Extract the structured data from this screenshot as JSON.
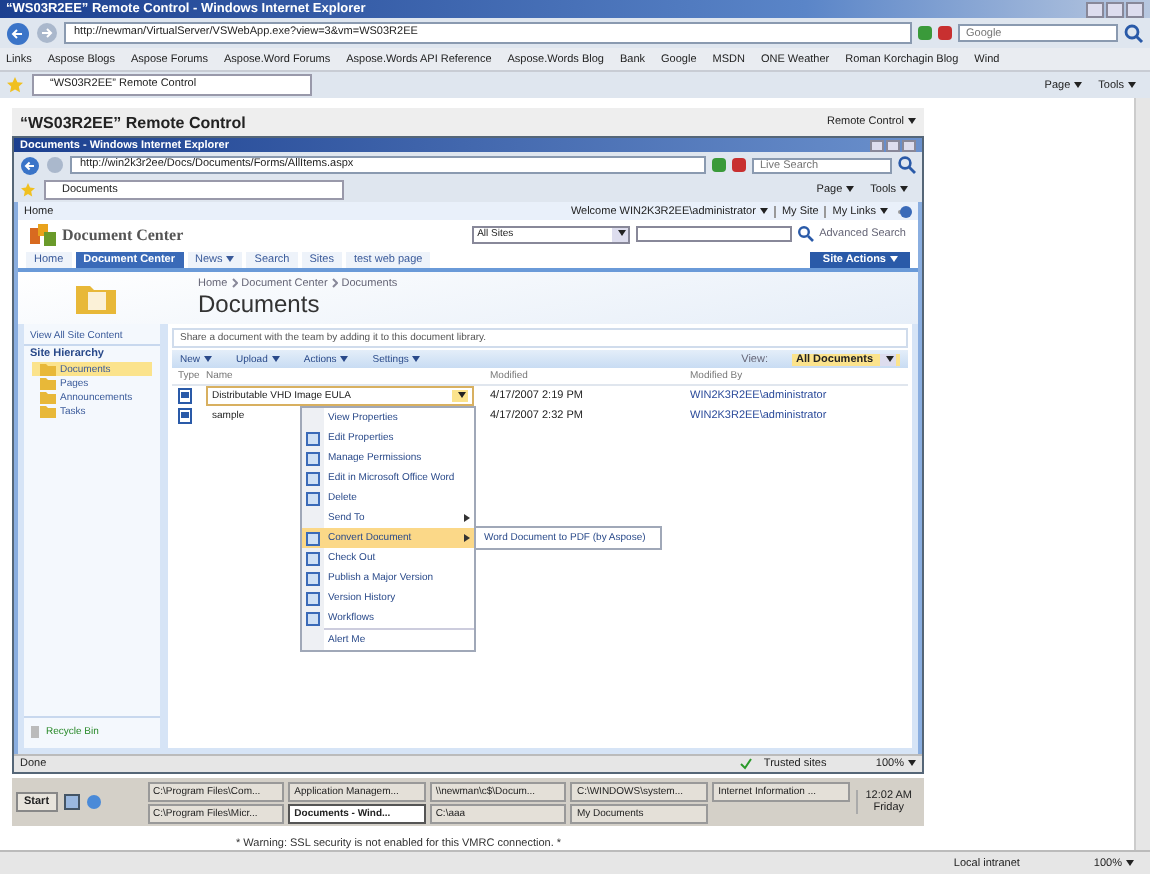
{
  "outer_window": {
    "title": "“WS03R2EE” Remote Control - Windows Internet Explorer",
    "address": "http://newman/VirtualServer/VSWebApp.exe?view=3&vm=WS03R2EE",
    "search_placeholder": "Google",
    "tab": "“WS03R2EE” Remote Control",
    "toolbar": [
      "Page",
      "Tools"
    ]
  },
  "links_bar": {
    "label": "Links",
    "links": [
      "Aspose Blogs",
      "Aspose Forums",
      "Aspose.Word Forums",
      "Aspose.Words API Reference",
      "Aspose.Words Blog",
      "Bank",
      "Google",
      "MSDN",
      "ONE Weather",
      "Roman Korchagin Blog",
      "Wind"
    ]
  },
  "remote_control": {
    "title": "“WS03R2EE” Remote Control",
    "menu": "Remote Control"
  },
  "inner_window": {
    "title": "Documents - Windows Internet Explorer",
    "address": "http://win2k3r2ee/Docs/Documents/Forms/AllItems.aspx",
    "search_placeholder": "Live Search",
    "tab": "Documents",
    "toolbar": [
      "Page",
      "Tools"
    ]
  },
  "site": {
    "top_link": "Home",
    "welcome": "Welcome WIN2K3R2EE\\administrator",
    "top_links": [
      "My Site",
      "My Links"
    ],
    "name": "Document Center",
    "scope": "All Sites",
    "advanced_search": "Advanced Search",
    "site_actions": "Site Actions",
    "nav": [
      {
        "label": "Home",
        "selected": false,
        "dropdown": false
      },
      {
        "label": "Document Center",
        "selected": true,
        "dropdown": false
      },
      {
        "label": "News",
        "selected": false,
        "dropdown": true
      },
      {
        "label": "Search",
        "selected": false,
        "dropdown": false
      },
      {
        "label": "Sites",
        "selected": false,
        "dropdown": false
      },
      {
        "label": "test web page",
        "selected": false,
        "dropdown": false
      }
    ],
    "breadcrumb": [
      "Home",
      "Document Center",
      "Documents"
    ],
    "page_title": "Documents"
  },
  "sidebar": {
    "view_all": "View All Site Content",
    "heading": "Site Hierarchy",
    "items": [
      {
        "label": "Documents",
        "selected": true
      },
      {
        "label": "Pages",
        "selected": false
      },
      {
        "label": "Announcements",
        "selected": false
      },
      {
        "label": "Tasks",
        "selected": false
      }
    ],
    "recycle_bin": "Recycle Bin"
  },
  "library": {
    "description": "Share a document with the team by adding it to this document library.",
    "toolbar": [
      "New",
      "Upload",
      "Actions",
      "Settings"
    ],
    "view_label": "View:",
    "view": "All Documents",
    "columns": [
      "Type",
      "Name",
      "Modified",
      "Modified By"
    ],
    "rows": [
      {
        "name": "Distributable VHD Image EULA",
        "modified": "4/17/2007 2:19 PM",
        "modified_by": "WIN2K3R2EE\\administrator",
        "selected": true
      },
      {
        "name": "sample",
        "modified": "4/17/2007 2:32 PM",
        "modified_by": "WIN2K3R2EE\\administrator",
        "selected": false
      }
    ]
  },
  "context_menu": {
    "items": [
      {
        "label": "View Properties",
        "has_icon": false,
        "submenu": false,
        "highlighted": false,
        "divider_before": false
      },
      {
        "label": "Edit Properties",
        "has_icon": true,
        "submenu": false,
        "highlighted": false,
        "divider_before": false
      },
      {
        "label": "Manage Permissions",
        "has_icon": true,
        "submenu": false,
        "highlighted": false,
        "divider_before": false
      },
      {
        "label": "Edit in Microsoft Office Word",
        "has_icon": true,
        "submenu": false,
        "highlighted": false,
        "divider_before": false
      },
      {
        "label": "Delete",
        "has_icon": true,
        "submenu": false,
        "highlighted": false,
        "divider_before": false
      },
      {
        "label": "Send To",
        "has_icon": false,
        "submenu": true,
        "highlighted": false,
        "divider_before": false
      },
      {
        "label": "Convert Document",
        "has_icon": true,
        "submenu": true,
        "highlighted": true,
        "divider_before": false
      },
      {
        "label": "Check Out",
        "has_icon": true,
        "submenu": false,
        "highlighted": false,
        "divider_before": false
      },
      {
        "label": "Publish a Major Version",
        "has_icon": true,
        "submenu": false,
        "highlighted": false,
        "divider_before": false
      },
      {
        "label": "Version History",
        "has_icon": true,
        "submenu": false,
        "highlighted": false,
        "divider_before": false
      },
      {
        "label": "Workflows",
        "has_icon": true,
        "submenu": false,
        "highlighted": false,
        "divider_before": false
      },
      {
        "label": "Alert Me",
        "has_icon": false,
        "submenu": false,
        "highlighted": false,
        "divider_before": true
      }
    ]
  },
  "submenu": {
    "items": [
      "Word Document to PDF (by Aspose)"
    ]
  },
  "inner_status": {
    "text": "Done",
    "zone": "Trusted sites",
    "zoom": "100%"
  },
  "taskbar": {
    "start": "Start",
    "buttons": [
      {
        "label": "C:\\Program Files\\Com...",
        "selected": false
      },
      {
        "label": "Application Managem...",
        "selected": false
      },
      {
        "label": "\\\\newman\\c$\\Docum...",
        "selected": false
      },
      {
        "label": "C:\\WINDOWS\\system...",
        "selected": false
      },
      {
        "label": "Internet Information ...",
        "selected": false
      },
      {
        "label": "C:\\Program Files\\Micr...",
        "selected": false
      },
      {
        "label": "Documents - Wind...",
        "selected": true
      },
      {
        "label": "C:\\aaa",
        "selected": false
      },
      {
        "label": "My Documents",
        "selected": false
      }
    ],
    "time": "12:02 AM",
    "day": "Friday"
  },
  "warning": "* Warning: SSL security is not enabled for this VMRC connection. *",
  "outer_status": {
    "zone": "Local intranet",
    "zoom": "100%"
  }
}
